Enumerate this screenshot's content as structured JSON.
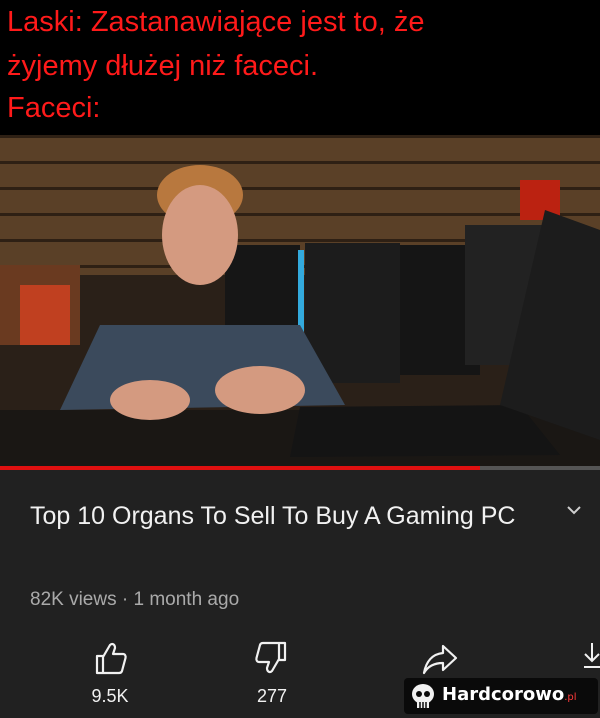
{
  "meme": {
    "line1": "Laski: Zastanawiające jest to, że",
    "line2": "żyjemy dłużej niż faceci.",
    "line3": "Faceci:"
  },
  "video": {
    "title": "Top 10 Organs To Sell To Buy A Gaming PC",
    "views": "82K views",
    "separator": " · ",
    "age": "1 month ago",
    "progress": 0.8
  },
  "actions": {
    "like_count": "9.5K",
    "dislike_count": "277"
  },
  "watermark": {
    "brand": "Hardcorowo",
    "tld": ".pl"
  },
  "colors": {
    "meme_text": "#ff1a1a",
    "progress": "#e01010",
    "panel_bg": "#212121"
  },
  "icons": [
    "chevron-down-icon",
    "thumbs-up-icon",
    "thumbs-down-icon",
    "share-icon",
    "download-icon",
    "skull-icon"
  ]
}
